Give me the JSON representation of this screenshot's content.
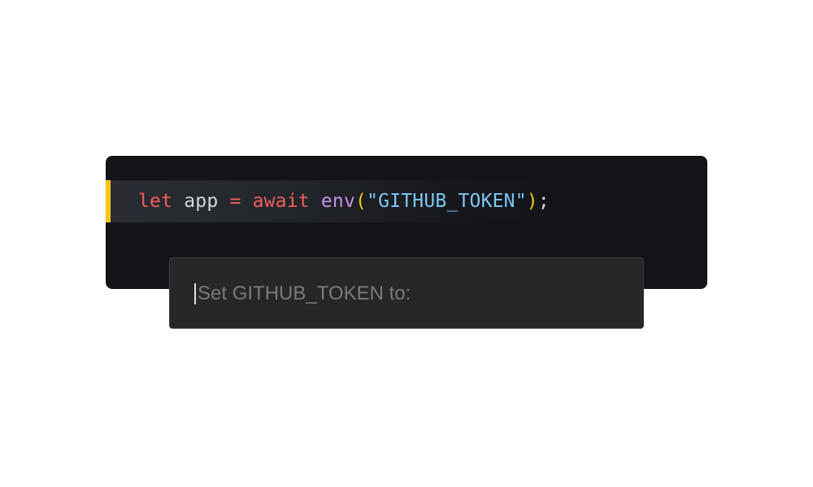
{
  "code": {
    "tokens": {
      "keyword_let": "let",
      "sp1": " ",
      "ident_app": "app",
      "sp2": " ",
      "op_eq": "=",
      "sp3": " ",
      "keyword_await": "await",
      "sp4": " ",
      "func_env": "env",
      "paren_open": "(",
      "string_token": "\"GITHUB_TOKEN\"",
      "paren_close": ")",
      "semicolon": ";"
    },
    "highlight_color": "#f5c518"
  },
  "prompt": {
    "placeholder": "Set GITHUB_TOKEN to:",
    "value": ""
  },
  "colors": {
    "keyword": "#f0605a",
    "function": "#c792ea",
    "string": "#7cc7f4",
    "paren": "#f5c518",
    "editor_background": "#121418",
    "prompt_background": "#272729"
  }
}
